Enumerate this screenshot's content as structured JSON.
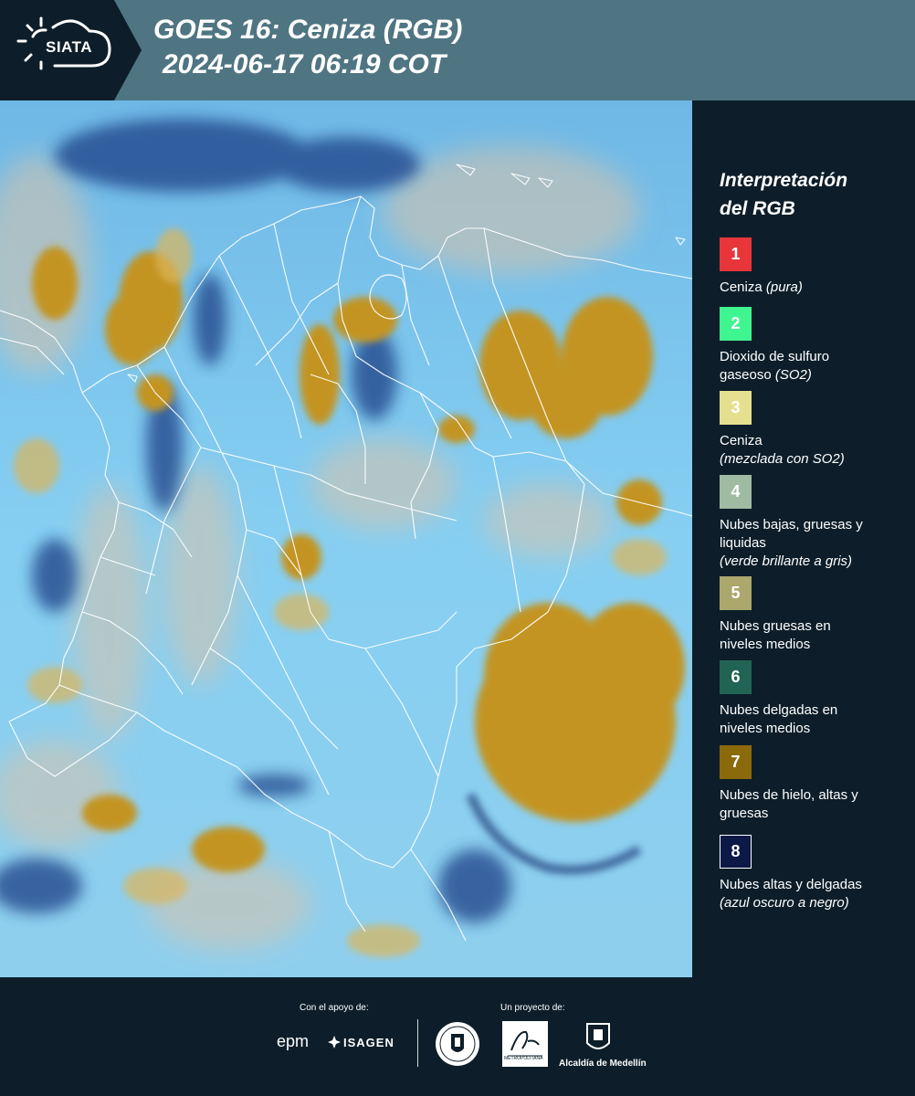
{
  "header": {
    "logo": "SIATA",
    "title_line1": "GOES 16: Ceniza (RGB)",
    "title_line2": "2024-06-17 06:19 COT",
    "bg_color": "#4f7583"
  },
  "legend": {
    "title_line1": "Interpretación",
    "title_line2": "del RGB",
    "items": [
      {
        "num": "1",
        "color": "#e8353a",
        "line1": "Ceniza",
        "line2": "",
        "italic": "(pura)",
        "italic_inline": true
      },
      {
        "num": "2",
        "color": "#3ff590",
        "line1": "Dioxido de sulfuro",
        "line2": "gaseoso",
        "italic": "(SO2)",
        "italic_inline": true
      },
      {
        "num": "3",
        "color": "#e5e08f",
        "line1": "Ceniza",
        "line2": "",
        "italic": "(mezclada con SO2)",
        "italic_inline": false
      },
      {
        "num": "4",
        "color": "#9fbba2",
        "line1": "Nubes bajas, gruesas y",
        "line2": "liquidas",
        "italic": "(verde brillante a gris)",
        "italic_inline": false
      },
      {
        "num": "5",
        "color": "#aca76c",
        "line1": "Nubes gruesas en",
        "line2": "niveles medios",
        "italic": "",
        "italic_inline": false
      },
      {
        "num": "6",
        "color": "#216454",
        "line1": "Nubes delgadas en",
        "line2": "niveles medios",
        "italic": "",
        "italic_inline": false
      },
      {
        "num": "7",
        "color": "#8b6a0c",
        "line1": "Nubes de hielo, altas y",
        "line2": "gruesas",
        "italic": "",
        "italic_inline": false
      },
      {
        "num": "8",
        "color": "#0c1846",
        "line1": "Nubes altas y delgadas",
        "line2": "",
        "italic": "(azul oscuro a negro)",
        "italic_inline": false
      }
    ]
  },
  "footer": {
    "support_label": "Con el apoyo de:",
    "project_label": "Un proyecto de:",
    "sponsors": [
      "epm",
      "ISAGEN"
    ],
    "partners": [
      "Área Metropolitana Valle de Aburrá",
      "Alcaldía de Medellín"
    ],
    "partner_caption": "Alcaldía de Medellín",
    "area_caption": "METROPOLITANA"
  }
}
